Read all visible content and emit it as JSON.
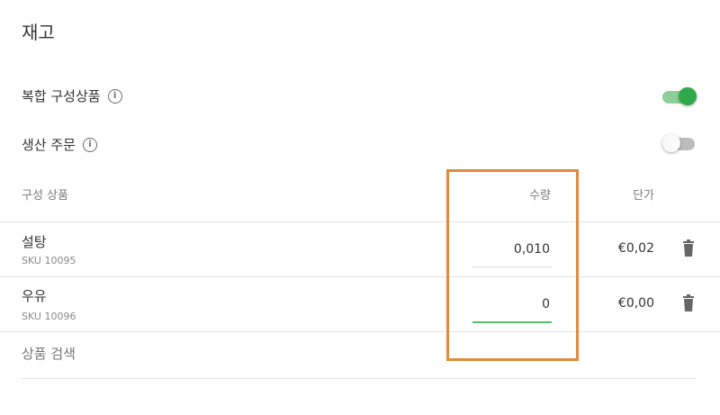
{
  "section": {
    "title": "재고"
  },
  "settings": {
    "composite_product": {
      "label": "복합 구성상품",
      "info_icon": "info-icon",
      "enabled": true
    },
    "production_order": {
      "label": "생산 주문",
      "info_icon": "info-icon",
      "enabled": false
    }
  },
  "table": {
    "headers": {
      "component": "구성 상품",
      "quantity": "수량",
      "unit_price": "단가"
    },
    "rows": [
      {
        "name": "설탕",
        "sku": "SKU 10095",
        "quantity": "0,010",
        "price": "€0,02",
        "delete_icon": "trash-icon"
      },
      {
        "name": "우유",
        "sku": "SKU 10096",
        "quantity": "0",
        "price": "€0,00",
        "delete_icon": "trash-icon"
      }
    ],
    "search_placeholder": "상품 검색"
  },
  "colors": {
    "toggle_on": "#2eaa4a",
    "toggle_on_track": "#8fcf9a",
    "toggle_off_track": "#bdbdbd",
    "active_underline": "#5cbf6e",
    "inactive_underline": "#d9d9d9",
    "highlight_box": "#e38a3c"
  }
}
